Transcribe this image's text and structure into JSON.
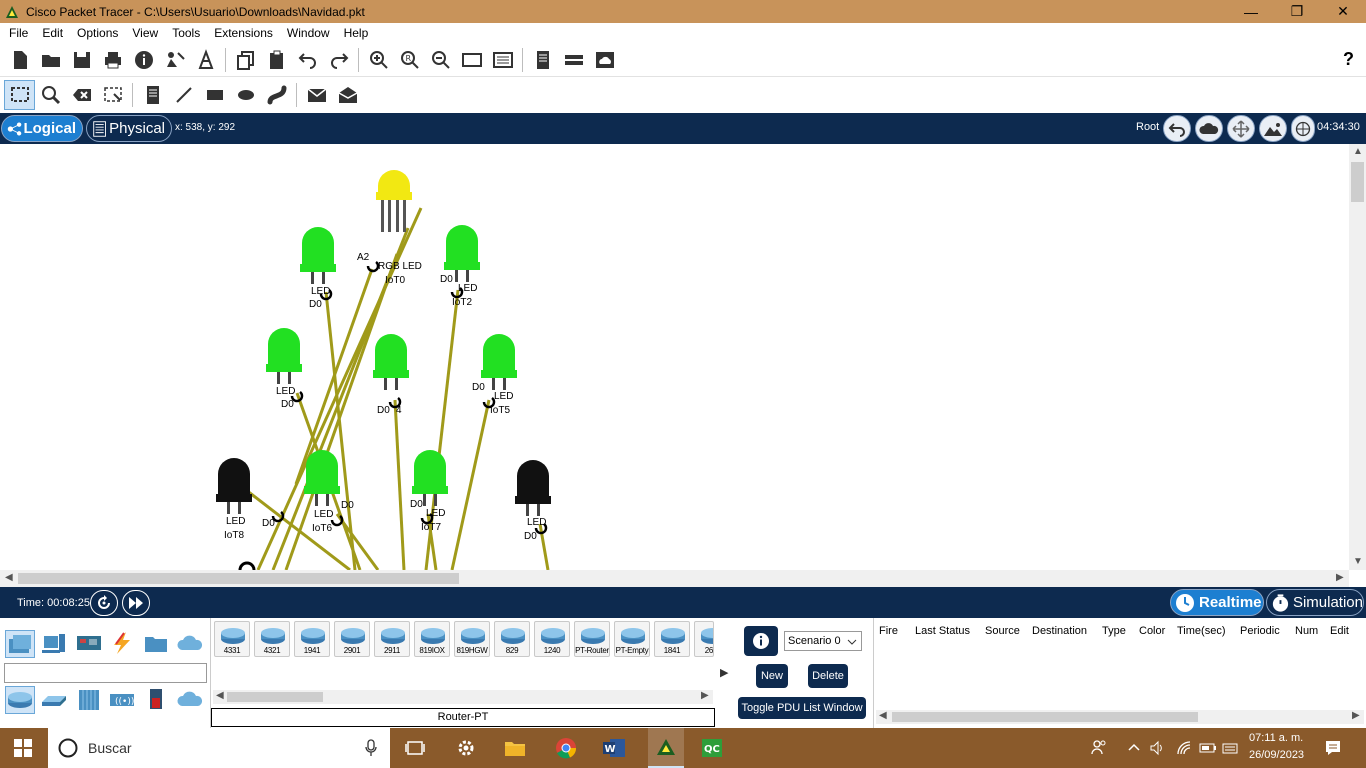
{
  "window": {
    "title": "Cisco Packet Tracer - C:\\Users\\Usuario\\Downloads\\Navidad.pkt"
  },
  "menu": {
    "items": [
      "File",
      "Edit",
      "Options",
      "View",
      "Tools",
      "Extensions",
      "Window",
      "Help"
    ]
  },
  "toolbar": {
    "help": "?"
  },
  "viewbar": {
    "logical": "Logical",
    "physical": "Physical",
    "coords": "x: 538, y: 292",
    "root": "Root",
    "clock": "04:34:30"
  },
  "workspace": {
    "labels": [
      {
        "id": "rgb-lbl",
        "text": "RGB LED"
      },
      {
        "id": "iot0",
        "text": "IoT0"
      },
      {
        "id": "a2",
        "text": "A2"
      },
      {
        "id": "led-l1",
        "text": "LED"
      },
      {
        "id": "d0-1",
        "text": "D0"
      },
      {
        "id": "d0-2",
        "text": "D0"
      },
      {
        "id": "led-2",
        "text": "LED"
      },
      {
        "id": "iot2",
        "text": "IoT2"
      },
      {
        "id": "led-3",
        "text": "LED"
      },
      {
        "id": "d0-3",
        "text": "D0"
      },
      {
        "id": "d0-4",
        "text": "D0"
      },
      {
        "id": "iot4",
        "text": "4"
      },
      {
        "id": "d0-5",
        "text": "D0"
      },
      {
        "id": "led-5",
        "text": "LED"
      },
      {
        "id": "iot5",
        "text": "IoT5"
      },
      {
        "id": "led-8",
        "text": "LED"
      },
      {
        "id": "iot8",
        "text": "IoT8"
      },
      {
        "id": "d0-8",
        "text": "D0"
      },
      {
        "id": "led-6",
        "text": "LED"
      },
      {
        "id": "iot6",
        "text": "IoT6"
      },
      {
        "id": "d0-6",
        "text": "D0"
      },
      {
        "id": "d0-7",
        "text": "D0"
      },
      {
        "id": "led-7",
        "text": "LED"
      },
      {
        "id": "iot7",
        "text": "IoT7"
      },
      {
        "id": "led-9",
        "text": "LED"
      },
      {
        "id": "d0-9",
        "text": "D0"
      }
    ]
  },
  "timebar": {
    "time": "Time: 00:08:25",
    "realtime": "Realtime",
    "simulation": "Simulation"
  },
  "devices": {
    "items": [
      "4331",
      "4321",
      "1941",
      "2901",
      "2911",
      "819IOX",
      "819HGW",
      "829",
      "1240",
      "PT-Router",
      "PT-Empty",
      "1841",
      "2620"
    ],
    "selected_name": "Router-PT"
  },
  "scenario": {
    "select": "Scenario 0",
    "new": "New",
    "delete": "Delete",
    "toggle": "Toggle PDU List Window"
  },
  "pdu_table": {
    "headers": [
      "Fire",
      "Last Status",
      "Source",
      "Destination",
      "Type",
      "Color",
      "Time(sec)",
      "Periodic",
      "Num",
      "Edit"
    ]
  },
  "taskbar": {
    "search": "Buscar",
    "time": "07:11 a. m.",
    "date": "26/09/2023"
  },
  "colors": {
    "led_green": "#22e022",
    "led_yellow": "#f2e812",
    "led_off": "#111111",
    "cable": "#a09a1a",
    "navy": "#0d2a4f",
    "accent": "#1d7fd1"
  }
}
